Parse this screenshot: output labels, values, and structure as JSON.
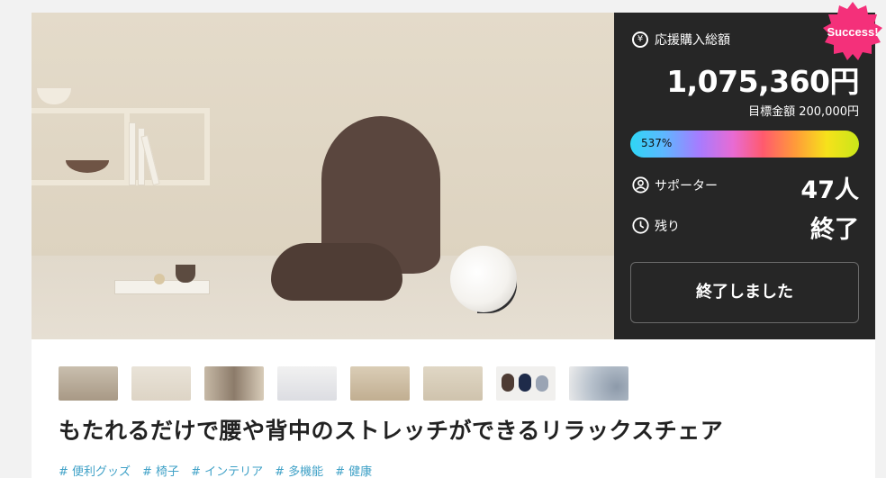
{
  "funding": {
    "total_label": "応援購入総額",
    "total_amount": "1,075,360円",
    "goal_text": "目標金額 200,000円",
    "progress_percent": "537%",
    "progress_value": 537,
    "supporters_label": "サポーター",
    "supporters_value": "47人",
    "remaining_label": "残り",
    "remaining_value": "終了",
    "ended_button": "終了しました",
    "badge": "Success!"
  },
  "icons": {
    "yen": "¥",
    "supporter": "person-circle-icon",
    "clock": "clock-icon"
  },
  "project": {
    "title": "もたれるだけで腰や背中のストレッチができるリラックスチェア",
    "tags": [
      "# 便利グッズ",
      "# 椅子",
      "# インテリア",
      "# 多機能",
      "# 健康"
    ]
  },
  "colors": {
    "panel_bg": "#262626",
    "badge": "#f4307a",
    "tag": "#3fa1c7"
  }
}
